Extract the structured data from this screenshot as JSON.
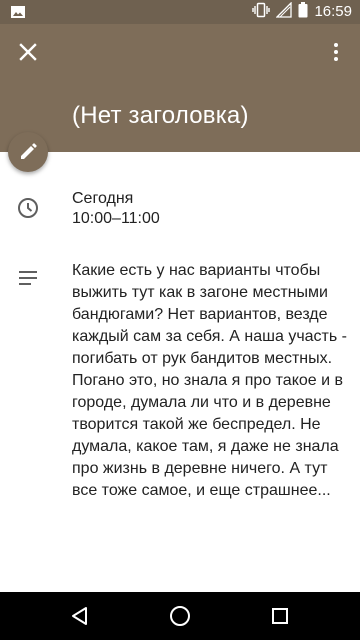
{
  "status_bar": {
    "time": "16:59",
    "icons": [
      "image-notification-icon",
      "vibrate-icon",
      "no-signal-icon",
      "battery-icon"
    ]
  },
  "header": {
    "title": "(Нет заголовка)",
    "background_color": "#7e6d59",
    "icons": [
      "close-icon",
      "more-vert-icon"
    ]
  },
  "event": {
    "date": "Сегодня",
    "time_range": "10:00–11:00",
    "description": "Какие есть у нас варианты чтобы выжить тут как в загоне местными бандюгами? Нет вариантов, везде каждый сам за себя. А наша участь - погибать от рук бандитов местных. Погано это, но знала я про такое и в городе, думала ли что и в деревне творится такой же беспредел. Не думала, какое там, я даже не знала про жизнь в деревне ничего. А тут все тоже самое, и еще страшнее..."
  },
  "nav_bar": {
    "icons": [
      "back-icon",
      "home-icon",
      "recents-icon"
    ]
  }
}
